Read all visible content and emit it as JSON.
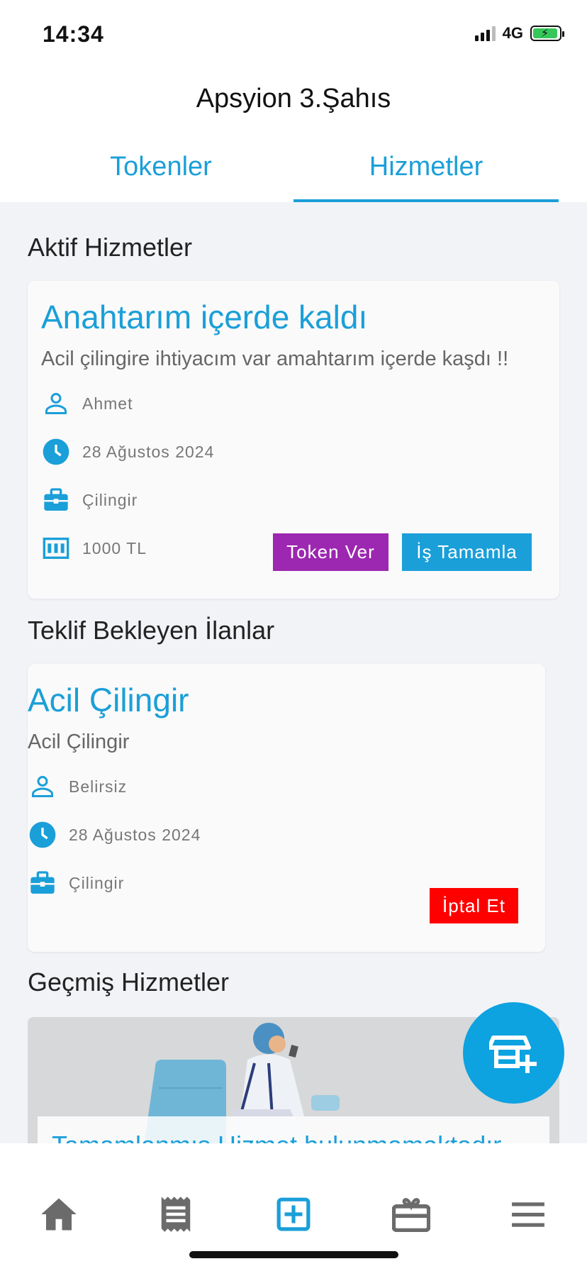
{
  "status_bar": {
    "time": "14:34",
    "network": "4G"
  },
  "header": {
    "title": "Apsyion 3.Şahıs",
    "tabs": [
      {
        "label": "Tokenler",
        "active": false
      },
      {
        "label": "Hizmetler",
        "active": true
      }
    ]
  },
  "active_services": {
    "section_title": "Aktif Hizmetler",
    "card": {
      "title": "Anahtarım içerde kaldı",
      "description": "Acil çilingire ihtiyacım var amahtarım içerde kaşdı !!",
      "person": "Ahmet",
      "date": "28 Ağustos 2024",
      "category": "Çilingir",
      "price": "1000 TL",
      "token_button": "Token Ver",
      "complete_button": "İş Tamamla"
    }
  },
  "pending_listings": {
    "section_title": "Teklif Bekleyen İlanlar",
    "card": {
      "title": "Acil Çilingir",
      "description": "Acil Çilingir",
      "person": "Belirsiz",
      "date": "28 Ağustos 2024",
      "category": "Çilingir",
      "cancel_button": "İptal Et"
    }
  },
  "past_services": {
    "section_title": "Geçmiş Hizmetler",
    "empty_text": "Tamamlanmış Hizmet bulunmamaktadır"
  },
  "bottom_nav": [
    {
      "icon": "home-icon",
      "active": false
    },
    {
      "icon": "receipt-icon",
      "active": false
    },
    {
      "icon": "add-box-icon",
      "active": true
    },
    {
      "icon": "gift-card-icon",
      "active": false
    },
    {
      "icon": "menu-icon",
      "active": false
    }
  ],
  "colors": {
    "accent": "#1a9fd8",
    "token_button": "#9c27b0",
    "cancel_button": "#ff0000",
    "fab": "#0da2e0",
    "nav_inactive": "#6b6b6b"
  }
}
